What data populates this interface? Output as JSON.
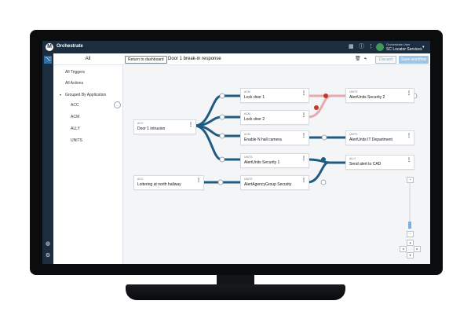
{
  "app": {
    "name": "Orchestrate",
    "logo_letter": "M"
  },
  "topbar": {
    "user_name": "Orchestrate User",
    "user_org": "SC Locator Services",
    "icons": [
      "grid-icon",
      "info-icon",
      "apps-icon"
    ]
  },
  "sidebar": {
    "header": "All",
    "items": [
      {
        "label": "All Triggers"
      },
      {
        "label": "All Actions"
      },
      {
        "label": "Grouped By Application"
      },
      {
        "label": "ACC"
      },
      {
        "label": "ACM"
      },
      {
        "label": "ALLY"
      },
      {
        "label": "UNITS"
      }
    ]
  },
  "toolbar": {
    "return_label": "Return to dashboard",
    "title": "Door 1 break-in response",
    "discard_label": "Discard",
    "save_label": "Save workflow"
  },
  "nodes": [
    {
      "type": "ACC",
      "label": "Door 1 intrusion"
    },
    {
      "type": "ACM",
      "label": "Lock door 1"
    },
    {
      "type": "ACM",
      "label": "Lock door 2"
    },
    {
      "type": "ACM",
      "label": "Enable N hall camera"
    },
    {
      "type": "UNITS",
      "label": "AlertUnits Security 1"
    },
    {
      "type": "UNITS",
      "label": "AlertUnits Security 2"
    },
    {
      "type": "UNITS",
      "label": "AlertUnits IT Department"
    },
    {
      "type": "ALLY",
      "label": "Send alert to CAD"
    },
    {
      "type": "ACC",
      "label": "Loitering at north hallway"
    },
    {
      "type": "UNITS",
      "label": "AlertAgencyGroup Security"
    }
  ],
  "zoom": {
    "plus": "+",
    "minus": "−",
    "level": 0.15
  },
  "colors": {
    "link": "#1f5b82",
    "link_disabled": "#e7a9b1",
    "danger": "#c0392b",
    "topbar": "#1c2d3f",
    "accent": "#9cc5e8"
  }
}
